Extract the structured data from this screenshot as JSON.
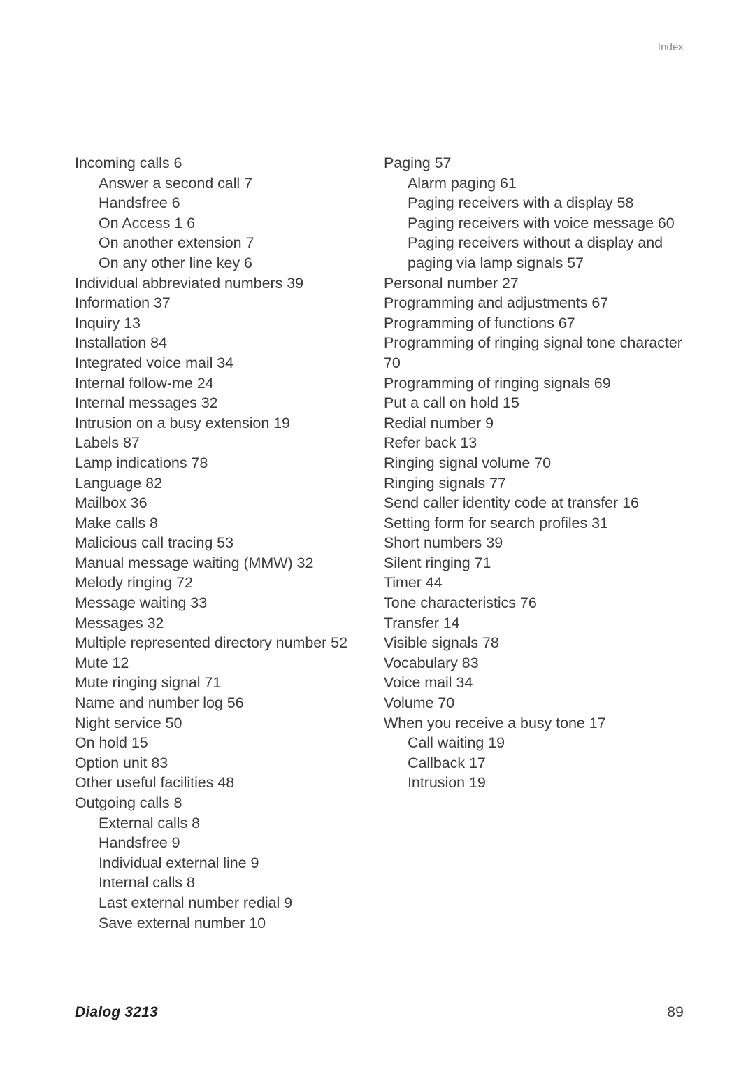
{
  "header": {
    "running_head": "Index"
  },
  "colors": {
    "page_background": "#ffffff",
    "body_text": "#3c3c3c",
    "running_head_text": "#8c8c8c",
    "footer_title_text": "#231f20"
  },
  "index": {
    "left_column": [
      {
        "level": 0,
        "text": "Incoming calls 6"
      },
      {
        "level": 1,
        "text": "Answer a second call 7"
      },
      {
        "level": 1,
        "text": "Handsfree 6"
      },
      {
        "level": 1,
        "text": "On Access 1 6"
      },
      {
        "level": 1,
        "text": "On another extension 7"
      },
      {
        "level": 1,
        "text": "On any other line key 6"
      },
      {
        "level": 0,
        "text": "Individual abbreviated numbers 39"
      },
      {
        "level": 0,
        "text": "Information 37"
      },
      {
        "level": 0,
        "text": "Inquiry 13"
      },
      {
        "level": 0,
        "text": "Installation 84"
      },
      {
        "level": 0,
        "text": "Integrated voice mail 34"
      },
      {
        "level": 0,
        "text": "Internal follow-me 24"
      },
      {
        "level": 0,
        "text": "Internal messages 32"
      },
      {
        "level": 0,
        "text": "Intrusion on a busy extension 19"
      },
      {
        "level": 0,
        "text": "Labels 87"
      },
      {
        "level": 0,
        "text": "Lamp indications 78"
      },
      {
        "level": 0,
        "text": "Language 82"
      },
      {
        "level": 0,
        "text": "Mailbox 36"
      },
      {
        "level": 0,
        "text": "Make calls 8"
      },
      {
        "level": 0,
        "text": "Malicious call tracing 53"
      },
      {
        "level": 0,
        "text": "Manual message waiting (MMW) 32"
      },
      {
        "level": 0,
        "text": "Melody ringing 72"
      },
      {
        "level": 0,
        "text": "Message waiting 33"
      },
      {
        "level": 0,
        "text": "Messages 32"
      },
      {
        "level": 0,
        "text": "Multiple represented directory number 52"
      },
      {
        "level": 0,
        "text": "Mute 12"
      },
      {
        "level": 0,
        "text": "Mute ringing signal 71"
      },
      {
        "level": 0,
        "text": "Name and number log 56"
      },
      {
        "level": 0,
        "text": "Night service 50"
      },
      {
        "level": 0,
        "text": "On hold 15"
      },
      {
        "level": 0,
        "text": "Option unit 83"
      },
      {
        "level": 0,
        "text": "Other useful facilities 48"
      },
      {
        "level": 0,
        "text": "Outgoing calls 8"
      },
      {
        "level": 1,
        "text": "External calls 8"
      },
      {
        "level": 1,
        "text": "Handsfree 9"
      },
      {
        "level": 1,
        "text": "Individual external line 9"
      },
      {
        "level": 1,
        "text": "Internal calls 8"
      },
      {
        "level": 1,
        "text": "Last external number redial 9"
      },
      {
        "level": 1,
        "text": "Save external number 10"
      }
    ],
    "right_column": [
      {
        "level": 0,
        "text": "Paging 57"
      },
      {
        "level": 1,
        "text": "Alarm paging 61"
      },
      {
        "level": 1,
        "text": "Paging receivers with a display 58"
      },
      {
        "level": 1,
        "text": "Paging receivers with voice message 60"
      },
      {
        "level": 1,
        "text": "Paging receivers without a display and paging via lamp signals 57"
      },
      {
        "level": 0,
        "text": "Personal number 27"
      },
      {
        "level": 0,
        "text": "Programming and adjustments 67"
      },
      {
        "level": 0,
        "text": "Programming of functions 67"
      },
      {
        "level": 0,
        "text": "Programming of ringing signal tone character 70"
      },
      {
        "level": 0,
        "text": "Programming of ringing signals 69"
      },
      {
        "level": 0,
        "text": "Put a call on hold 15"
      },
      {
        "level": 0,
        "text": "Redial number 9"
      },
      {
        "level": 0,
        "text": "Refer back 13"
      },
      {
        "level": 0,
        "text": "Ringing signal volume 70"
      },
      {
        "level": 0,
        "text": "Ringing signals 77"
      },
      {
        "level": 0,
        "text": "Send caller identity code at transfer 16"
      },
      {
        "level": 0,
        "text": "Setting form for search profiles 31"
      },
      {
        "level": 0,
        "text": "Short numbers 39"
      },
      {
        "level": 0,
        "text": "Silent ringing 71"
      },
      {
        "level": 0,
        "text": "Timer 44"
      },
      {
        "level": 0,
        "text": "Tone characteristics 76"
      },
      {
        "level": 0,
        "text": "Transfer 14"
      },
      {
        "level": 0,
        "text": "Visible signals 78"
      },
      {
        "level": 0,
        "text": "Vocabulary 83"
      },
      {
        "level": 0,
        "text": "Voice mail 34"
      },
      {
        "level": 0,
        "text": "Volume 70"
      },
      {
        "level": 0,
        "text": "When you receive a busy tone 17"
      },
      {
        "level": 1,
        "text": "Call waiting 19"
      },
      {
        "level": 1,
        "text": "Callback 17"
      },
      {
        "level": 1,
        "text": "Intrusion 19"
      }
    ]
  },
  "footer": {
    "title": "Dialog 3213",
    "page_number": "89"
  }
}
